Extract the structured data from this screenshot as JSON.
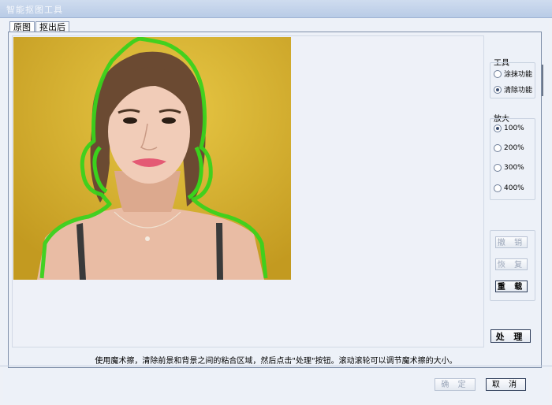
{
  "window": {
    "title": "智能抠图工具"
  },
  "tabs": [
    "原图",
    "抠出后"
  ],
  "tools": {
    "title": "工具",
    "options": [
      {
        "label": "涂抹功能",
        "selected": false
      },
      {
        "label": "清除功能",
        "selected": true
      }
    ]
  },
  "zoom": {
    "title": "放大",
    "options": [
      {
        "label": "100%",
        "selected": true
      },
      {
        "label": "200%",
        "selected": false
      },
      {
        "label": "300%",
        "selected": false
      },
      {
        "label": "400%",
        "selected": false
      }
    ]
  },
  "edit_buttons": {
    "undo": "撤 销",
    "redo": "恢 复",
    "reset": "重 载"
  },
  "process_button": "处 理",
  "hint": "使用魔术擦，清除前景和背景之间的粘合区域，然后点击\"处理\"按钮。滚动滚轮可以调节魔术擦的大小。",
  "footer": {
    "ok": "确 定",
    "cancel": "取 消"
  },
  "colors": {
    "photo_background": "#d6b131",
    "outline": "#3ad21c"
  }
}
